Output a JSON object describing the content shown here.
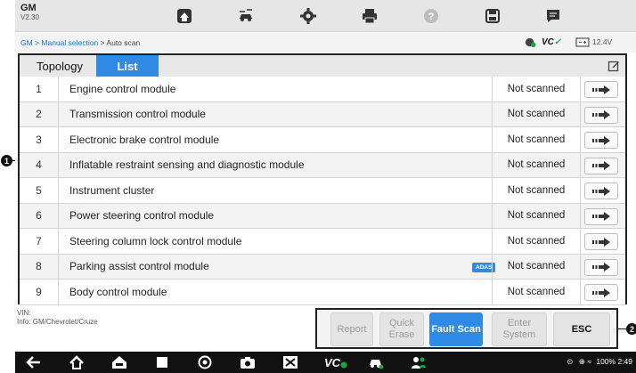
{
  "header": {
    "make": "GM",
    "version": "V2.30",
    "icons": [
      "home-icon",
      "vehicle-swap-icon",
      "settings-icon",
      "print-icon",
      "help-icon",
      "save-icon",
      "message-icon"
    ]
  },
  "breadcrumb": {
    "root": "GM",
    "sep1": " > ",
    "middle": "Manual selection",
    "sep2": " > ",
    "current": "Auto scan"
  },
  "status": {
    "vci_label": "VC",
    "battery_voltage": "12.4V"
  },
  "tabs": {
    "topology": "Topology",
    "list": "List"
  },
  "modules": [
    {
      "num": "1",
      "name": "Engine control module",
      "status": "Not scanned"
    },
    {
      "num": "2",
      "name": "Transmission control module",
      "status": "Not scanned"
    },
    {
      "num": "3",
      "name": "Electronic brake control module",
      "status": "Not scanned"
    },
    {
      "num": "4",
      "name": "Inflatable restraint sensing and diagnostic module",
      "status": "Not scanned"
    },
    {
      "num": "5",
      "name": "Instrument cluster",
      "status": "Not scanned"
    },
    {
      "num": "6",
      "name": "Power steering control module",
      "status": "Not scanned"
    },
    {
      "num": "7",
      "name": "Steering column lock control module",
      "status": "Not scanned"
    },
    {
      "num": "8",
      "name": "Parking assist control module",
      "status": "Not scanned",
      "badge": "ADAS"
    },
    {
      "num": "9",
      "name": "Body control module",
      "status": "Not scanned"
    }
  ],
  "info": {
    "vin": "VIN:",
    "vehicle": "Info: GM/Chevrolet/Cruze"
  },
  "actions": {
    "report": "Report",
    "quick_erase_1": "Quick",
    "quick_erase_2": "Erase",
    "fault_scan": "Fault Scan",
    "enter_system_1": "Enter",
    "enter_system_2": "System",
    "esc": "ESC"
  },
  "system_bar": {
    "status_text": "100% 2:49"
  },
  "callouts": {
    "one": "1",
    "two": "2"
  },
  "colors": {
    "accent": "#2f8ae6",
    "vci_green": "#1aa34a",
    "toolbar_bg": "#e6e6e6",
    "navbar_bg": "#111111"
  }
}
